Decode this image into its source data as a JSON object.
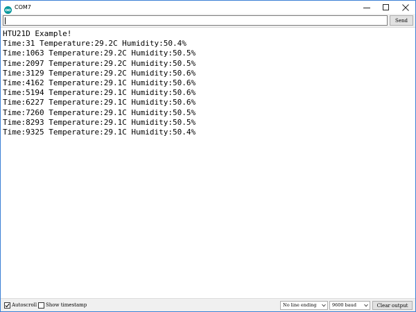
{
  "window": {
    "title": "COM7"
  },
  "input": {
    "value": "",
    "send_label": "Send"
  },
  "output": {
    "lines": [
      "HTU21D Example!",
      "Time:31 Temperature:29.2C Humidity:50.4%",
      "Time:1063 Temperature:29.2C Humidity:50.5%",
      "Time:2097 Temperature:29.2C Humidity:50.5%",
      "Time:3129 Temperature:29.2C Humidity:50.6%",
      "Time:4162 Temperature:29.1C Humidity:50.6%",
      "Time:5194 Temperature:29.1C Humidity:50.6%",
      "Time:6227 Temperature:29.1C Humidity:50.6%",
      "Time:7260 Temperature:29.1C Humidity:50.5%",
      "Time:8293 Temperature:29.1C Humidity:50.5%",
      "Time:9325 Temperature:29.1C Humidity:50.4%"
    ]
  },
  "statusbar": {
    "autoscroll_label": "Autoscroll",
    "autoscroll_checked": true,
    "timestamp_label": "Show timestamp",
    "timestamp_checked": false,
    "line_ending": "No line ending",
    "baud_rate": "9600 baud",
    "clear_label": "Clear output"
  },
  "icons": {
    "app": "arduino-icon",
    "minimize": "minimize-icon",
    "maximize": "maximize-icon",
    "close": "close-icon",
    "dropdown": "chevron-down-icon",
    "check": "checkmark-icon"
  },
  "colors": {
    "app_icon": "#00979c",
    "window_border": "#3a7fd4",
    "chrome_bg": "#f0f0f0",
    "button_bg": "#e1e1e1"
  }
}
